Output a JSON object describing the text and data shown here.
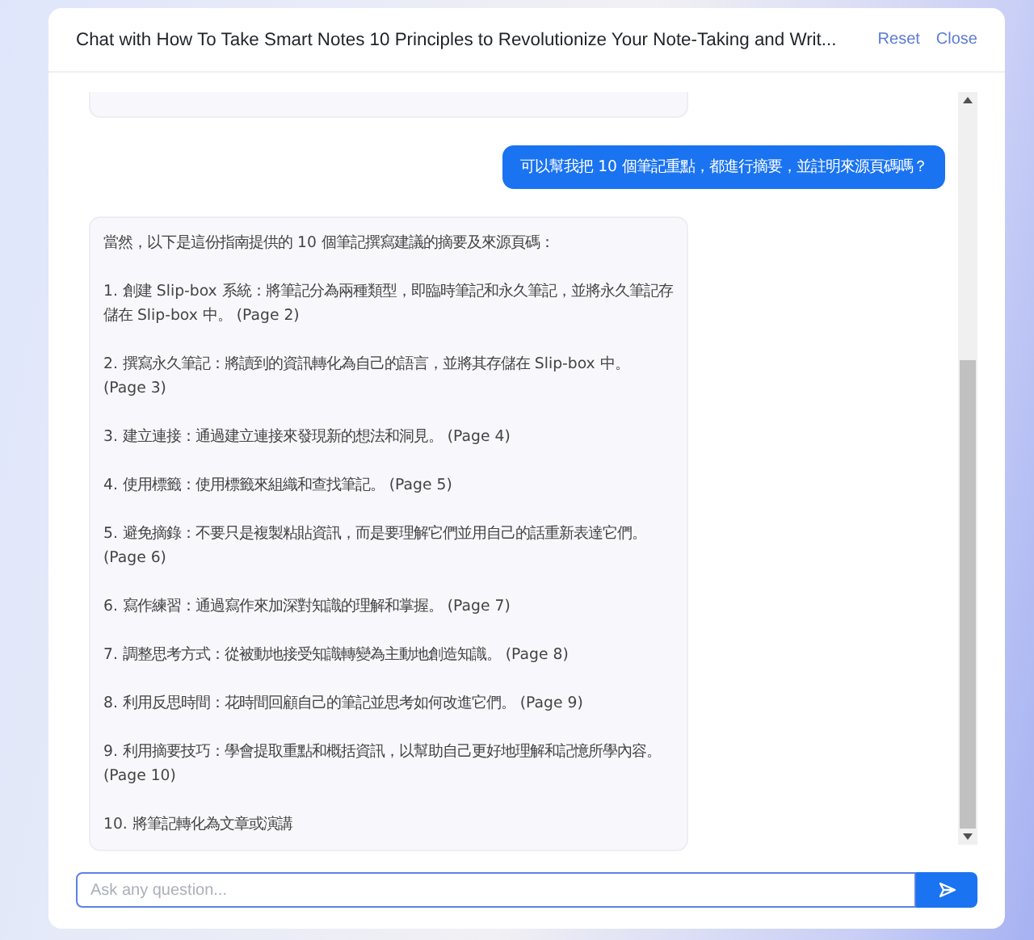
{
  "dialog": {
    "title": "Chat with How To Take Smart Notes 10 Principles to Revolutionize Your Note-Taking and Writ...",
    "actions": [
      "Reset",
      "Close"
    ]
  },
  "messages": [
    {
      "kind": "cut"
    },
    {
      "kind": "user",
      "paragraphs": [
        "可以幫我把 10 個筆記重點，都進行摘要，並註明來源頁碼嗎？"
      ]
    },
    {
      "kind": "assistant",
      "paragraphs": [
        "當然，以下是這份指南提供的 10 個筆記撰寫建議的摘要及來源頁碼：",
        "1. 創建 Slip-box 系統：將筆記分為兩種類型，即臨時筆記和永久筆記，並將永久筆記存儲在 Slip-box 中。 (Page 2)",
        "2. 撰寫永久筆記：將讀到的資訊轉化為自己的語言，並將其存儲在 Slip-box 中。 (Page 3)",
        "3. 建立連接：通過建立連接來發現新的想法和洞見。 (Page 4)",
        "4. 使用標籤：使用標籤來組織和查找筆記。 (Page 5)",
        "5. 避免摘錄：不要只是複製粘貼資訊，而是要理解它們並用自己的話重新表達它們。 (Page 6)",
        "6. 寫作練習：通過寫作來加深對知識的理解和掌握。 (Page 7)",
        "7. 調整思考方式：從被動地接受知識轉變為主動地創造知識。 (Page 8)",
        "8. 利用反思時間：花時間回顧自己的筆記並思考如何改進它們。 (Page 9)",
        "9. 利用摘要技巧：學會提取重點和概括資訊，以幫助自己更好地理解和記憶所學內容。 (Page 10)",
        "10. 將筆記轉化為文章或演講"
      ]
    }
  ],
  "composer": {
    "placeholder": "Ask any question..."
  }
}
